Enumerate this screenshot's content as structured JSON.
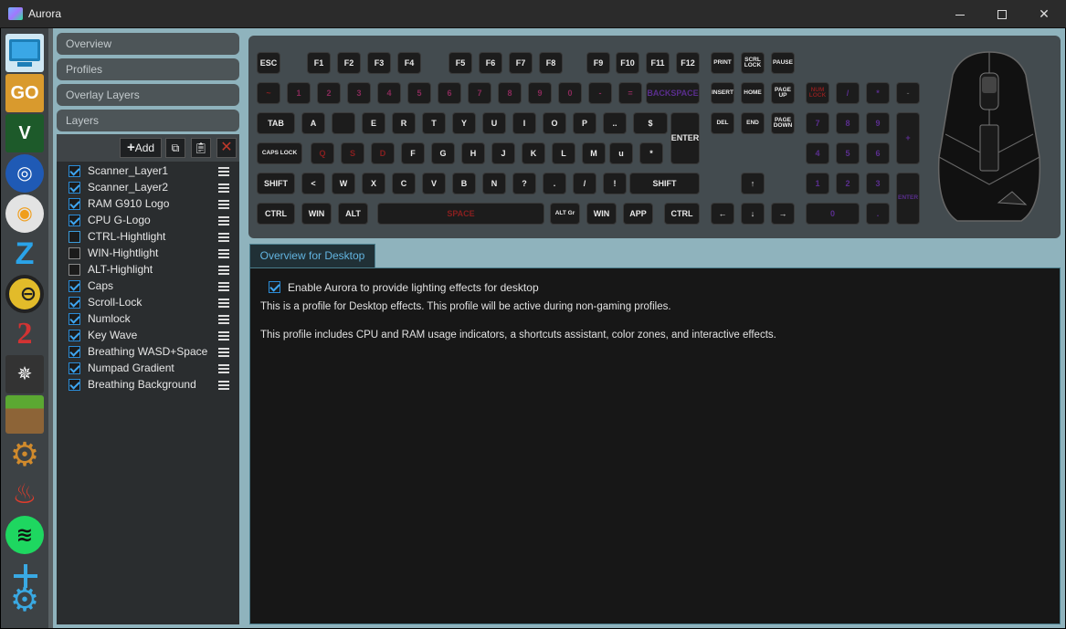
{
  "window": {
    "title": "Aurora",
    "minimize_icon": "minimize-icon",
    "maximize_icon": "maximize-icon",
    "close_icon": "close-icon"
  },
  "profiles": [
    {
      "name": "desktop",
      "icon": "monitor-icon"
    },
    {
      "name": "csgo",
      "icon": "csgo-icon",
      "glyph": "GO"
    },
    {
      "name": "gta5",
      "icon": "gta-v-icon",
      "glyph": "V"
    },
    {
      "name": "rocket-league",
      "icon": "rocket-league-icon",
      "glyph": "◎"
    },
    {
      "name": "overwatch",
      "icon": "overwatch-icon",
      "glyph": "◉"
    },
    {
      "name": "z-profile",
      "icon": "z-logo-icon",
      "glyph": "Z"
    },
    {
      "name": "overwatch-2",
      "icon": "circle-bar-icon",
      "glyph": "⊖"
    },
    {
      "name": "guild-wars-2",
      "icon": "gw2-icon",
      "glyph": "2"
    },
    {
      "name": "witcher",
      "icon": "wolf-medallion-icon",
      "glyph": "✵"
    },
    {
      "name": "minecraft",
      "icon": "grass-block-icon"
    },
    {
      "name": "generic-app",
      "icon": "gear-icon",
      "glyph": "⚙"
    },
    {
      "name": "fire-app",
      "icon": "flame-icon",
      "glyph": "♨"
    },
    {
      "name": "spotify",
      "icon": "spotify-icon",
      "glyph": "≋"
    }
  ],
  "add_profile_icon": "add-profile-gear-icon",
  "sections": {
    "overview": "Overview",
    "profiles": "Profiles",
    "overlay_layers": "Overlay Layers",
    "layers": "Layers"
  },
  "layer_tools": {
    "add_label": "Add",
    "add_icon": "plus-icon",
    "copy_icon": "copy-icon",
    "paste_icon": "clipboard-icon",
    "delete_icon": "delete-x-icon"
  },
  "layers": [
    {
      "name": "Scanner_Layer1",
      "enabled": true
    },
    {
      "name": "Scanner_Layer2",
      "enabled": true
    },
    {
      "name": "RAM G910 Logo",
      "enabled": true
    },
    {
      "name": "CPU G-Logo",
      "enabled": true
    },
    {
      "name": "CTRL-Hightlight",
      "enabled": false
    },
    {
      "name": "WIN-Hightlight",
      "enabled": false
    },
    {
      "name": "ALT-Highlight",
      "enabled": false
    },
    {
      "name": "Caps",
      "enabled": true
    },
    {
      "name": "Scroll-Lock",
      "enabled": true
    },
    {
      "name": "Numlock",
      "enabled": true
    },
    {
      "name": "Key Wave",
      "enabled": true
    },
    {
      "name": "Breathing WASD+Space",
      "enabled": true
    },
    {
      "name": "Numpad Gradient",
      "enabled": true
    },
    {
      "name": "Breathing Background",
      "enabled": true
    }
  ],
  "keyboard": {
    "row_fn": [
      "ESC",
      "F1",
      "F2",
      "F3",
      "F4",
      "F5",
      "F6",
      "F7",
      "F8",
      "F9",
      "F10",
      "F11",
      "F12",
      "PRINT",
      "SCRL LOCK",
      "PAUSE"
    ],
    "row_num": [
      "~",
      "1",
      "2",
      "3",
      "4",
      "5",
      "6",
      "7",
      "8",
      "9",
      "0",
      "-",
      "=",
      "BACKSPACE",
      "INSERT",
      "HOME",
      "PAGE UP",
      "NUM LOCK",
      "/",
      "*",
      "-"
    ],
    "row_tab": [
      "TAB",
      "A",
      "",
      "E",
      "R",
      "T",
      "Y",
      "U",
      "I",
      "O",
      "P",
      "..",
      "$",
      "ENTER",
      "DEL",
      "END",
      "PAGE DOWN",
      "7",
      "8",
      "9",
      "+"
    ],
    "row_caps": [
      "CAPS LOCK",
      "Q",
      "S",
      "D",
      "F",
      "G",
      "H",
      "J",
      "K",
      "L",
      "M",
      "u",
      "*",
      "4",
      "5",
      "6"
    ],
    "row_shift": [
      "SHIFT",
      "<",
      "W",
      "X",
      "C",
      "V",
      "B",
      "N",
      "?",
      ".",
      "/",
      "!",
      "SHIFT",
      "↑",
      "1",
      "2",
      "3",
      "ENTER"
    ],
    "row_ctrl": [
      "CTRL",
      "WIN",
      "ALT",
      "SPACE",
      "ALT Gr",
      "WIN",
      "APP",
      "CTRL",
      "←",
      "↓",
      "→",
      "0",
      "."
    ]
  },
  "mouse_icon": "corsair-mouse-icon",
  "tab": {
    "label": "Overview for Desktop"
  },
  "content": {
    "enable_label": "Enable Aurora to provide lighting effects for desktop",
    "enable_checked": true,
    "desc1": "This is a profile for Desktop effects. This profile will be active during non-gaming profiles.",
    "desc2": "This profile includes CPU and RAM usage indicators, a shortcuts assistant, color zones, and interactive effects."
  },
  "colors": {
    "accent": "#3fa6f0",
    "app_bg": "#8fb3bd",
    "panel_bg": "#2a2d2f",
    "keyboard_bg": "#434b4f"
  }
}
